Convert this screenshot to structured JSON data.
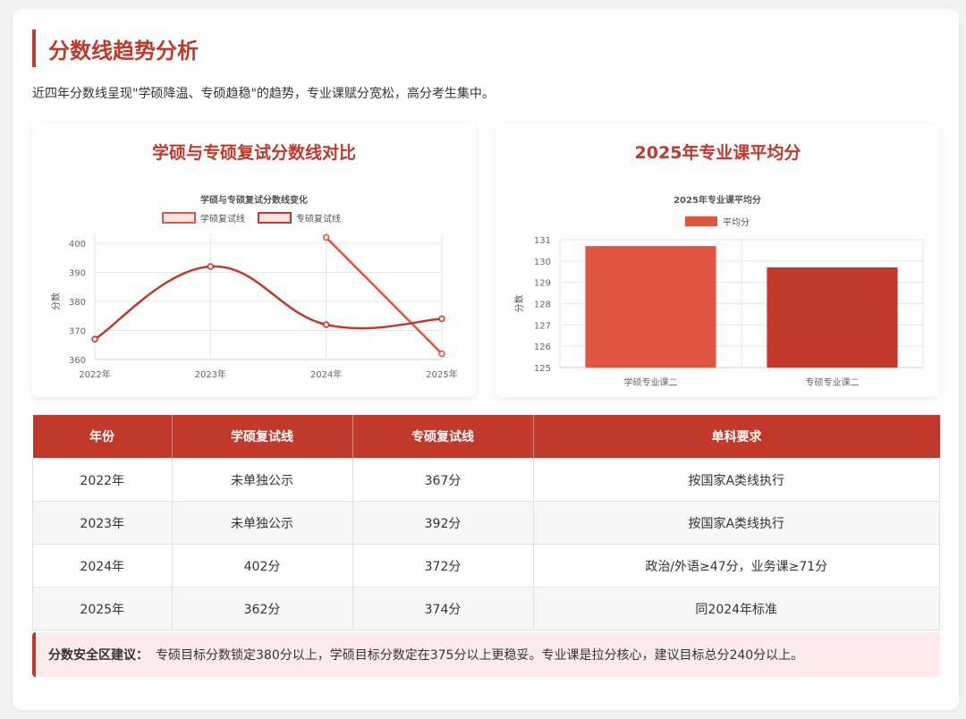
{
  "header": {
    "title": "分数线趋势分析",
    "intro": "近四年分数线呈现\"学硕降温、专硕趋稳\"的趋势，专业课赋分宽松，高分考生集中。"
  },
  "colors": {
    "accent": "#c0392b",
    "bar1": "#e05442",
    "bar2": "#c0392b",
    "tint": "#fdeaea"
  },
  "cards": {
    "line": {
      "card_title": "学硕与专硕复试分数线对比"
    },
    "bar": {
      "card_title": "2025年专业课平均分"
    }
  },
  "chart_data": [
    {
      "type": "line",
      "title": "学硕与专硕复试分数线变化",
      "ylabel": "分数",
      "categories": [
        "2022年",
        "2023年",
        "2024年",
        "2025年"
      ],
      "ylim": [
        360,
        400
      ],
      "yticks": [
        360,
        370,
        380,
        390,
        400
      ],
      "grid": true,
      "legend_position": "top",
      "series": [
        {
          "name": "学硕复试线",
          "values": [
            null,
            null,
            402,
            362
          ],
          "color": "#e05442"
        },
        {
          "name": "专硕复试线",
          "values": [
            367,
            392,
            372,
            374
          ],
          "color": "#c0392b"
        }
      ]
    },
    {
      "type": "bar",
      "title": "2025年专业课平均分",
      "ylabel": "分数",
      "categories": [
        "学硕专业课二",
        "专硕专业课二"
      ],
      "ylim": [
        125,
        131
      ],
      "yticks": [
        125,
        126,
        127,
        128,
        129,
        130,
        131
      ],
      "grid": true,
      "legend_position": "top",
      "series": [
        {
          "name": "平均分",
          "values": [
            130.7,
            129.7
          ],
          "colors": [
            "#e05442",
            "#c0392b"
          ]
        }
      ]
    }
  ],
  "table": {
    "headers": [
      "年份",
      "学硕复试线",
      "专硕复试线",
      "单科要求"
    ],
    "rows": [
      [
        "2022年",
        "未单独公示",
        "367分",
        "按国家A类线执行"
      ],
      [
        "2023年",
        "未单独公示",
        "392分",
        "按国家A类线执行"
      ],
      [
        "2024年",
        "402分",
        "372分",
        "政治/外语≥47分，业务课≥71分"
      ],
      [
        "2025年",
        "362分",
        "374分",
        "同2024年标准"
      ]
    ]
  },
  "advice": {
    "label": "分数安全区建议：",
    "text": "专硕目标分数锁定380分以上，学硕目标分数定在375分以上更稳妥。专业课是拉分核心，建议目标总分240分以上。"
  }
}
